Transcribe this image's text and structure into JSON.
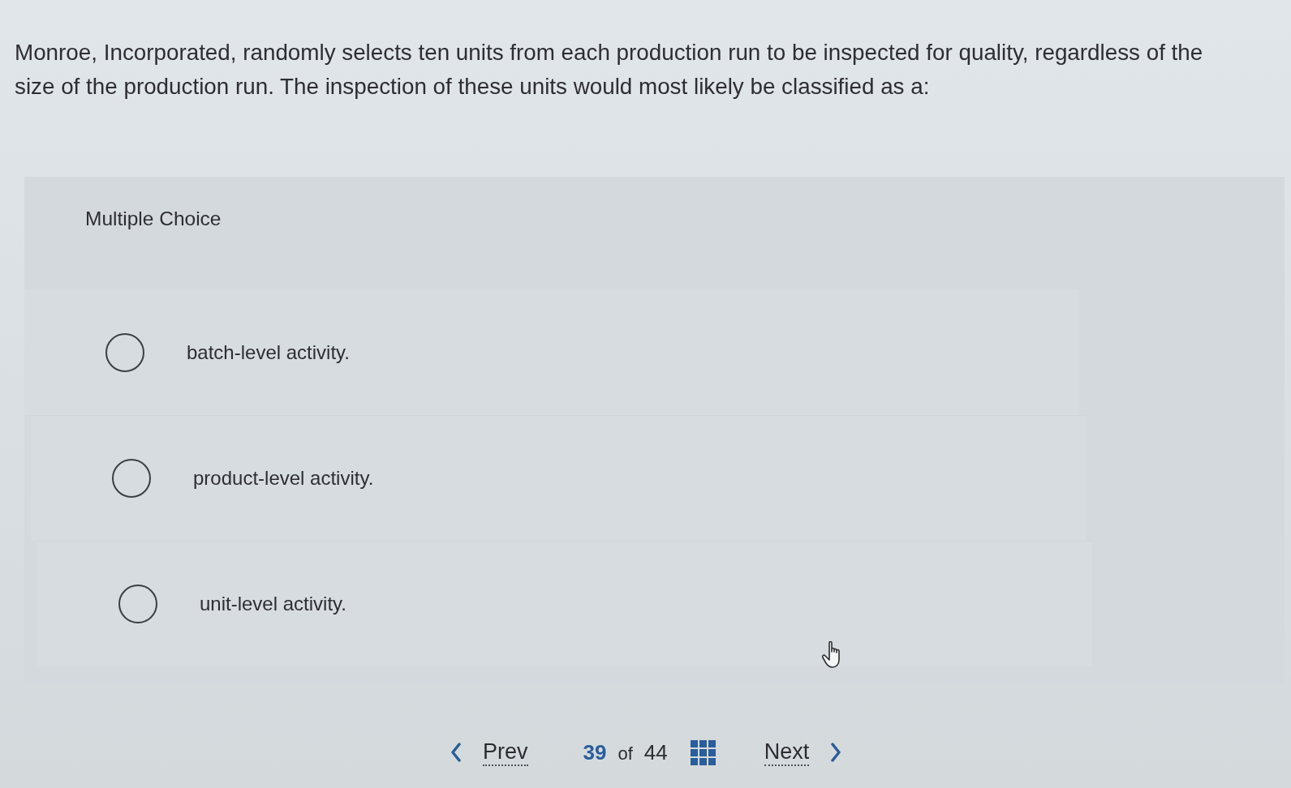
{
  "question": {
    "text": "Monroe, Incorporated, randomly selects ten units from each production run to be inspected for quality, regardless of the size of the production run. The inspection of these units would most likely be classified as a:"
  },
  "answer_area": {
    "label": "Multiple Choice",
    "options": [
      {
        "text": "batch-level activity.",
        "selected": false
      },
      {
        "text": "product-level activity.",
        "selected": false
      },
      {
        "text": "unit-level activity.",
        "selected": false
      }
    ]
  },
  "pagination": {
    "prev": "Prev",
    "current": "39",
    "of": "of",
    "total": "44",
    "next": "Next"
  }
}
